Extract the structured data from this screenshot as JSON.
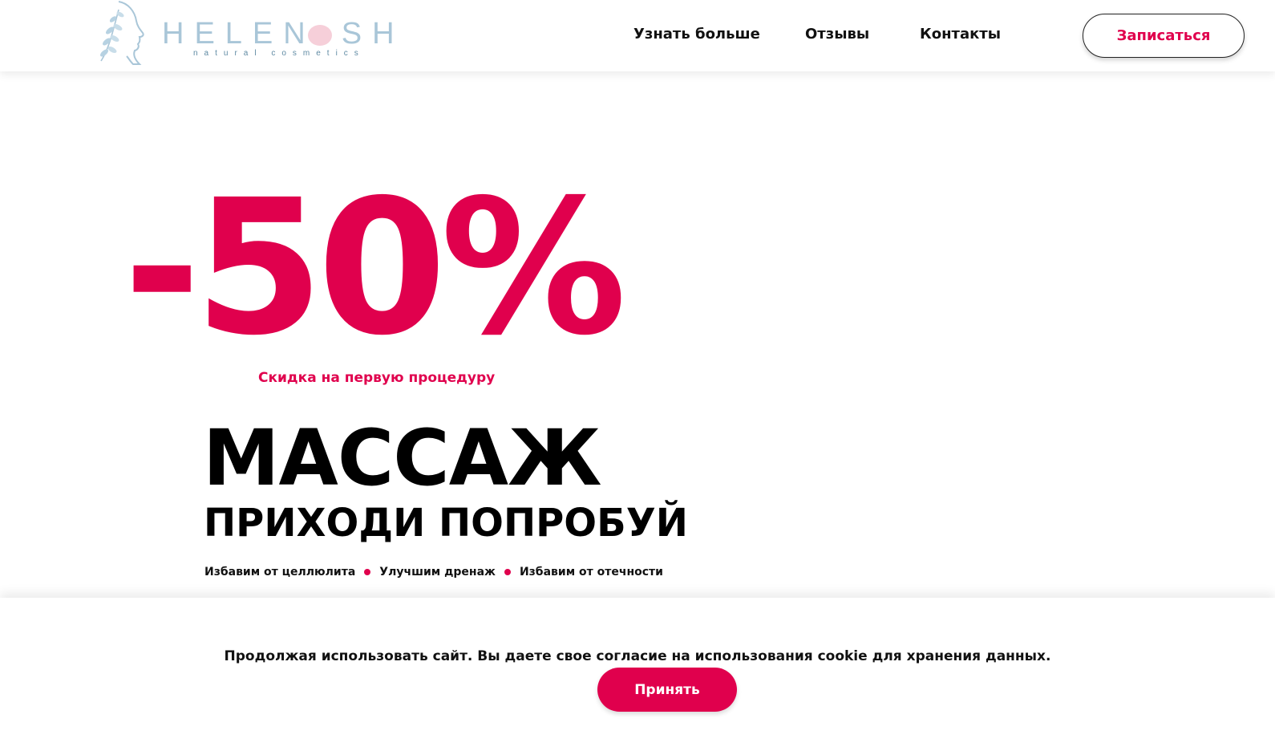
{
  "brand": {
    "logo_word": "HELENOSH",
    "logo_word_left": "HELEN",
    "logo_word_right": "SH",
    "logo_tagline": "natural cosmetics",
    "logo_color": "#a9c6d8",
    "logo_dot_color": "#f6cfd9"
  },
  "nav": {
    "items": [
      {
        "label": "Узнать больше"
      },
      {
        "label": "Отзывы"
      },
      {
        "label": "Контакты"
      }
    ],
    "cta_label": "Записаться"
  },
  "hero": {
    "discount": "-50%",
    "discount_caption": "Скидка на первую процедуру",
    "title": "МАССАЖ",
    "subtitle": "ПРИХОДИ ПОПРОБУЙ",
    "benefits": [
      "Избавим от целлюлита",
      "Улучшим дренаж",
      "Избавим от отечности"
    ]
  },
  "cookie": {
    "text": "Продолжая использовать сайт. Вы даете свое согласие на использования cookie для хранения данных.",
    "accept_label": "Принять"
  },
  "colors": {
    "accent": "#e0004d",
    "text": "#111111",
    "background": "#ffffff"
  }
}
